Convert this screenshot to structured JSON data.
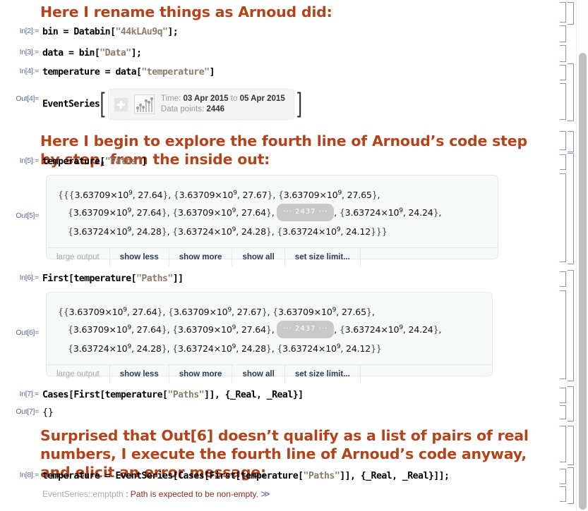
{
  "app": {
    "kind": "mathematica-notebook",
    "accent_text_color": "#b3431b",
    "io_label_color": "#5c6a99",
    "bracket_color": "#8d91b8",
    "output_box_bg": "#f7f9f9",
    "error_color": "#8b2b1f"
  },
  "cells": {
    "text1": "Here I rename things as Arnoud did:",
    "text2": "Here I begin to explore the fourth line of Arnoud’s code step by step, from the inside out:",
    "text3": "Surprised that Out[6] doesn’t qualify as a list of pairs of real numbers, I execute the fourth line of Arnoud’s code anyway, and elicit an error message:",
    "in2": {
      "label": "In[2]:=",
      "code": "bin = Databin[\"44kLAu9q\"];"
    },
    "in3": {
      "label": "In[3]:=",
      "code": "data = bin[\"Data\"];"
    },
    "in4": {
      "label": "In[4]:=",
      "code": "temperature = data[\"temperature\"]"
    },
    "out4": {
      "label": "Out[4]=",
      "head": "EventSeries",
      "summary": {
        "time_label": "Time:",
        "time_from": "03 Apr 2015",
        "time_joiner": "to",
        "time_to": "05 Apr 2015",
        "points_label": "Data points:",
        "points_value": "2446",
        "expand_icon": "plus-icon",
        "preview_icon": "stem-plot-icon"
      }
    },
    "in5": {
      "label": "In[5]:=",
      "code": "temperature[\"Paths\"]"
    },
    "out5": {
      "label": "Out[5]=",
      "lines": [
        "{{{3.63709×10⁹, 27.64}, {3.63709×10⁹, 27.67}, {3.63709×10⁹, 27.65},",
        "{3.63709×10⁹, 27.64}, {3.63709×10⁹, 27.64}, ··· 2437 ··· , {3.63724×10⁹, 24.24},",
        "{3.63724×10⁹, 24.28}, {3.63724×10⁹, 24.28}, {3.63724×10⁹, 24.12}}}"
      ],
      "skip_badge": "··· 2437 ···",
      "buttons": [
        "large output",
        "show less",
        "show more",
        "show all",
        "set size limit..."
      ]
    },
    "in6": {
      "label": "In[6]:=",
      "code": "First[temperature[\"Paths\"]]"
    },
    "out6": {
      "label": "Out[6]=",
      "lines": [
        "{{3.63709×10⁹, 27.64}, {3.63709×10⁹, 27.67}, {3.63709×10⁹, 27.65},",
        "{3.63709×10⁹, 27.64}, {3.63709×10⁹, 27.64}, ··· 2437 ··· , {3.63724×10⁹, 24.24},",
        "{3.63724×10⁹, 24.28}, {3.63724×10⁹, 24.28}, {3.63724×10⁹, 24.12}}"
      ],
      "skip_badge": "··· 2437 ···",
      "buttons": [
        "large output",
        "show less",
        "show more",
        "show all",
        "set size limit..."
      ]
    },
    "in7": {
      "label": "In[7]:=",
      "code": "Cases[First[temperature[\"Paths\"]], {_Real, _Real}]"
    },
    "out7": {
      "label": "Out[7]=",
      "code": "{}"
    },
    "in8": {
      "label": "In[8]:=",
      "code": "temperature = EventSeries[Cases[First[temperature[\"Paths\"]], {_Real, _Real}]];"
    },
    "message8": {
      "tag": "EventSeries::emptpth",
      "separator": ":",
      "body": "Path is expected to be non-empty.",
      "more": "≫"
    }
  },
  "expr_tokens": {
    "out5": [
      [
        {
          "t": "bk",
          "v": "{{{"
        },
        {
          "t": "n",
          "v": "3.63709×10"
        },
        {
          "t": "sup",
          "v": "9"
        },
        {
          "t": "n",
          "v": ", 27.64"
        },
        {
          "t": "bk",
          "v": "}"
        },
        {
          "t": "n",
          "v": ", "
        },
        {
          "t": "bk",
          "v": "{"
        },
        {
          "t": "n",
          "v": "3.63709×10"
        },
        {
          "t": "sup",
          "v": "9"
        },
        {
          "t": "n",
          "v": ", 27.67"
        },
        {
          "t": "bk",
          "v": "}"
        },
        {
          "t": "n",
          "v": ", "
        },
        {
          "t": "bk",
          "v": "{"
        },
        {
          "t": "n",
          "v": "3.63709×10"
        },
        {
          "t": "sup",
          "v": "9"
        },
        {
          "t": "n",
          "v": ", 27.65"
        },
        {
          "t": "bk",
          "v": "}"
        },
        {
          "t": "n",
          "v": ","
        }
      ],
      [
        {
          "t": "bk",
          "v": "{"
        },
        {
          "t": "n",
          "v": "3.63709×10"
        },
        {
          "t": "sup",
          "v": "9"
        },
        {
          "t": "n",
          "v": ", 27.64"
        },
        {
          "t": "bk",
          "v": "}"
        },
        {
          "t": "n",
          "v": ", "
        },
        {
          "t": "bk",
          "v": "{"
        },
        {
          "t": "n",
          "v": "3.63709×10"
        },
        {
          "t": "sup",
          "v": "9"
        },
        {
          "t": "n",
          "v": ", 27.64"
        },
        {
          "t": "bk",
          "v": "}"
        },
        {
          "t": "n",
          "v": ", "
        },
        {
          "t": "skip",
          "v": "2437"
        },
        {
          "t": "n",
          "v": ", "
        },
        {
          "t": "bk",
          "v": "{"
        },
        {
          "t": "n",
          "v": "3.63724×10"
        },
        {
          "t": "sup",
          "v": "9"
        },
        {
          "t": "n",
          "v": ", 24.24"
        },
        {
          "t": "bk",
          "v": "}"
        },
        {
          "t": "n",
          "v": ","
        }
      ],
      [
        {
          "t": "bk",
          "v": "{"
        },
        {
          "t": "n",
          "v": "3.63724×10"
        },
        {
          "t": "sup",
          "v": "9"
        },
        {
          "t": "n",
          "v": ", 24.28"
        },
        {
          "t": "bk",
          "v": "}"
        },
        {
          "t": "n",
          "v": ", "
        },
        {
          "t": "bk",
          "v": "{"
        },
        {
          "t": "n",
          "v": "3.63724×10"
        },
        {
          "t": "sup",
          "v": "9"
        },
        {
          "t": "n",
          "v": ", 24.28"
        },
        {
          "t": "bk",
          "v": "}"
        },
        {
          "t": "n",
          "v": ", "
        },
        {
          "t": "bk",
          "v": "{"
        },
        {
          "t": "n",
          "v": "3.63724×10"
        },
        {
          "t": "sup",
          "v": "9"
        },
        {
          "t": "n",
          "v": ", 24.12"
        },
        {
          "t": "bk",
          "v": "}}}"
        }
      ]
    ],
    "out6": [
      [
        {
          "t": "bk",
          "v": "{{"
        },
        {
          "t": "n",
          "v": "3.63709×10"
        },
        {
          "t": "sup",
          "v": "9"
        },
        {
          "t": "n",
          "v": ", 27.64"
        },
        {
          "t": "bk",
          "v": "}"
        },
        {
          "t": "n",
          "v": ", "
        },
        {
          "t": "bk",
          "v": "{"
        },
        {
          "t": "n",
          "v": "3.63709×10"
        },
        {
          "t": "sup",
          "v": "9"
        },
        {
          "t": "n",
          "v": ", 27.67"
        },
        {
          "t": "bk",
          "v": "}"
        },
        {
          "t": "n",
          "v": ", "
        },
        {
          "t": "bk",
          "v": "{"
        },
        {
          "t": "n",
          "v": "3.63709×10"
        },
        {
          "t": "sup",
          "v": "9"
        },
        {
          "t": "n",
          "v": ", 27.65"
        },
        {
          "t": "bk",
          "v": "}"
        },
        {
          "t": "n",
          "v": ","
        }
      ],
      [
        {
          "t": "bk",
          "v": "{"
        },
        {
          "t": "n",
          "v": "3.63709×10"
        },
        {
          "t": "sup",
          "v": "9"
        },
        {
          "t": "n",
          "v": ", 27.64"
        },
        {
          "t": "bk",
          "v": "}"
        },
        {
          "t": "n",
          "v": ", "
        },
        {
          "t": "bk",
          "v": "{"
        },
        {
          "t": "n",
          "v": "3.63709×10"
        },
        {
          "t": "sup",
          "v": "9"
        },
        {
          "t": "n",
          "v": ", 27.64"
        },
        {
          "t": "bk",
          "v": "}"
        },
        {
          "t": "n",
          "v": ", "
        },
        {
          "t": "skip",
          "v": "2437"
        },
        {
          "t": "n",
          "v": ", "
        },
        {
          "t": "bk",
          "v": "{"
        },
        {
          "t": "n",
          "v": "3.63724×10"
        },
        {
          "t": "sup",
          "v": "9"
        },
        {
          "t": "n",
          "v": ", 24.24"
        },
        {
          "t": "bk",
          "v": "}"
        },
        {
          "t": "n",
          "v": ","
        }
      ],
      [
        {
          "t": "bk",
          "v": "{"
        },
        {
          "t": "n",
          "v": "3.63724×10"
        },
        {
          "t": "sup",
          "v": "9"
        },
        {
          "t": "n",
          "v": ", 24.28"
        },
        {
          "t": "bk",
          "v": "}"
        },
        {
          "t": "n",
          "v": ", "
        },
        {
          "t": "bk",
          "v": "{"
        },
        {
          "t": "n",
          "v": "3.63724×10"
        },
        {
          "t": "sup",
          "v": "9"
        },
        {
          "t": "n",
          "v": ", 24.28"
        },
        {
          "t": "bk",
          "v": "}"
        },
        {
          "t": "n",
          "v": ", "
        },
        {
          "t": "bk",
          "v": "{"
        },
        {
          "t": "n",
          "v": "3.63724×10"
        },
        {
          "t": "sup",
          "v": "9"
        },
        {
          "t": "n",
          "v": ", 24.12"
        },
        {
          "t": "bk",
          "v": "}}"
        }
      ]
    ]
  },
  "code_tokens": {
    "in2": [
      {
        "t": "p",
        "v": "bin = Databin["
      },
      {
        "t": "s",
        "v": "\"44kLAu9q\""
      },
      {
        "t": "p",
        "v": "];"
      }
    ],
    "in3": [
      {
        "t": "p",
        "v": "data = bin["
      },
      {
        "t": "s",
        "v": "\"Data\""
      },
      {
        "t": "p",
        "v": "];"
      }
    ],
    "in4": [
      {
        "t": "p",
        "v": "temperature = data["
      },
      {
        "t": "s",
        "v": "\"temperature\""
      },
      {
        "t": "p",
        "v": "]"
      }
    ],
    "in5": [
      {
        "t": "p",
        "v": "temperature["
      },
      {
        "t": "s",
        "v": "\"Paths\""
      },
      {
        "t": "p",
        "v": "]"
      }
    ],
    "in6": [
      {
        "t": "p",
        "v": "First[temperature["
      },
      {
        "t": "s",
        "v": "\"Paths\""
      },
      {
        "t": "p",
        "v": "]]"
      }
    ],
    "in7": [
      {
        "t": "p",
        "v": "Cases[First[temperature["
      },
      {
        "t": "s",
        "v": "\"Paths\""
      },
      {
        "t": "p",
        "v": "]], {_Real, _Real}]"
      }
    ],
    "in8": [
      {
        "t": "p",
        "v": "temperature = EventSeries[Cases[First[temperature["
      },
      {
        "t": "s",
        "v": "\"Paths\""
      },
      {
        "t": "p",
        "v": "]], {_Real, _Real}]];"
      }
    ]
  },
  "scrollbar": {
    "name": "vertical-scrollbar"
  }
}
